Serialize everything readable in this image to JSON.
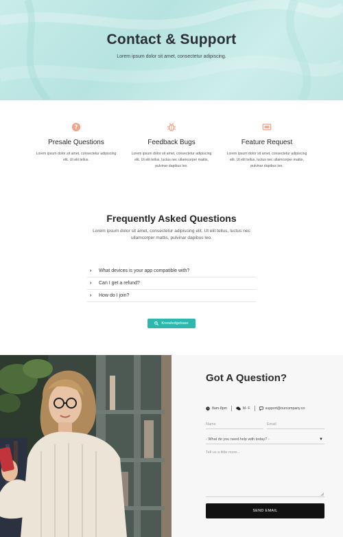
{
  "hero": {
    "title": "Contact & Support",
    "subtitle": "Lorem ipsum dolor sit amet, consectetur adipiscing."
  },
  "features": [
    {
      "icon": "question-circle-icon",
      "title": "Presale Questions",
      "text": "Lorem ipsum dolor sit amet, consectetur adipiscing elit. Ut elit tellus."
    },
    {
      "icon": "bug-icon",
      "title": "Feedback Bugs",
      "text": "Lorem ipsum dolor sit amet, consectetur adipiscing elit. Ut elit tellus, luctus nec ullamcorper mattis, pulvinar dapibus leo."
    },
    {
      "icon": "ticket-icon",
      "title": "Feature Request",
      "text": "Lorem ipsum dolor sit amet, consectetur adipiscing elit. Ut elit tellus, luctus nec ullamcorper mattis, pulvinar dapibus leo."
    }
  ],
  "faq": {
    "title": "Frequently Asked Questions",
    "subtitle": "Lorem ipsum dolor sit amet, consectetur adipiscing elit. Ut elit tellus, luctus nec ullamcorper mattis, pulvinar dapibus leo.",
    "items": [
      "What devices is your app compatible with?",
      "Can I get a refund?",
      "How do I join?"
    ],
    "button_label": "Knowledgebase"
  },
  "contact": {
    "title": "Got A Question?",
    "hours": "8am-8pm",
    "days": "M- F",
    "email": "support@ourcompany.co",
    "name_placeholder": "Name",
    "email_placeholder": "Email",
    "select_value": "- What do you need help with today? -",
    "message_placeholder": "Tell us a little more...",
    "send_label": "SEND EMAIL"
  },
  "colors": {
    "accent": "#2db8ad",
    "icon": "#f4a48c",
    "hero_bg": "#c4e9e5"
  }
}
